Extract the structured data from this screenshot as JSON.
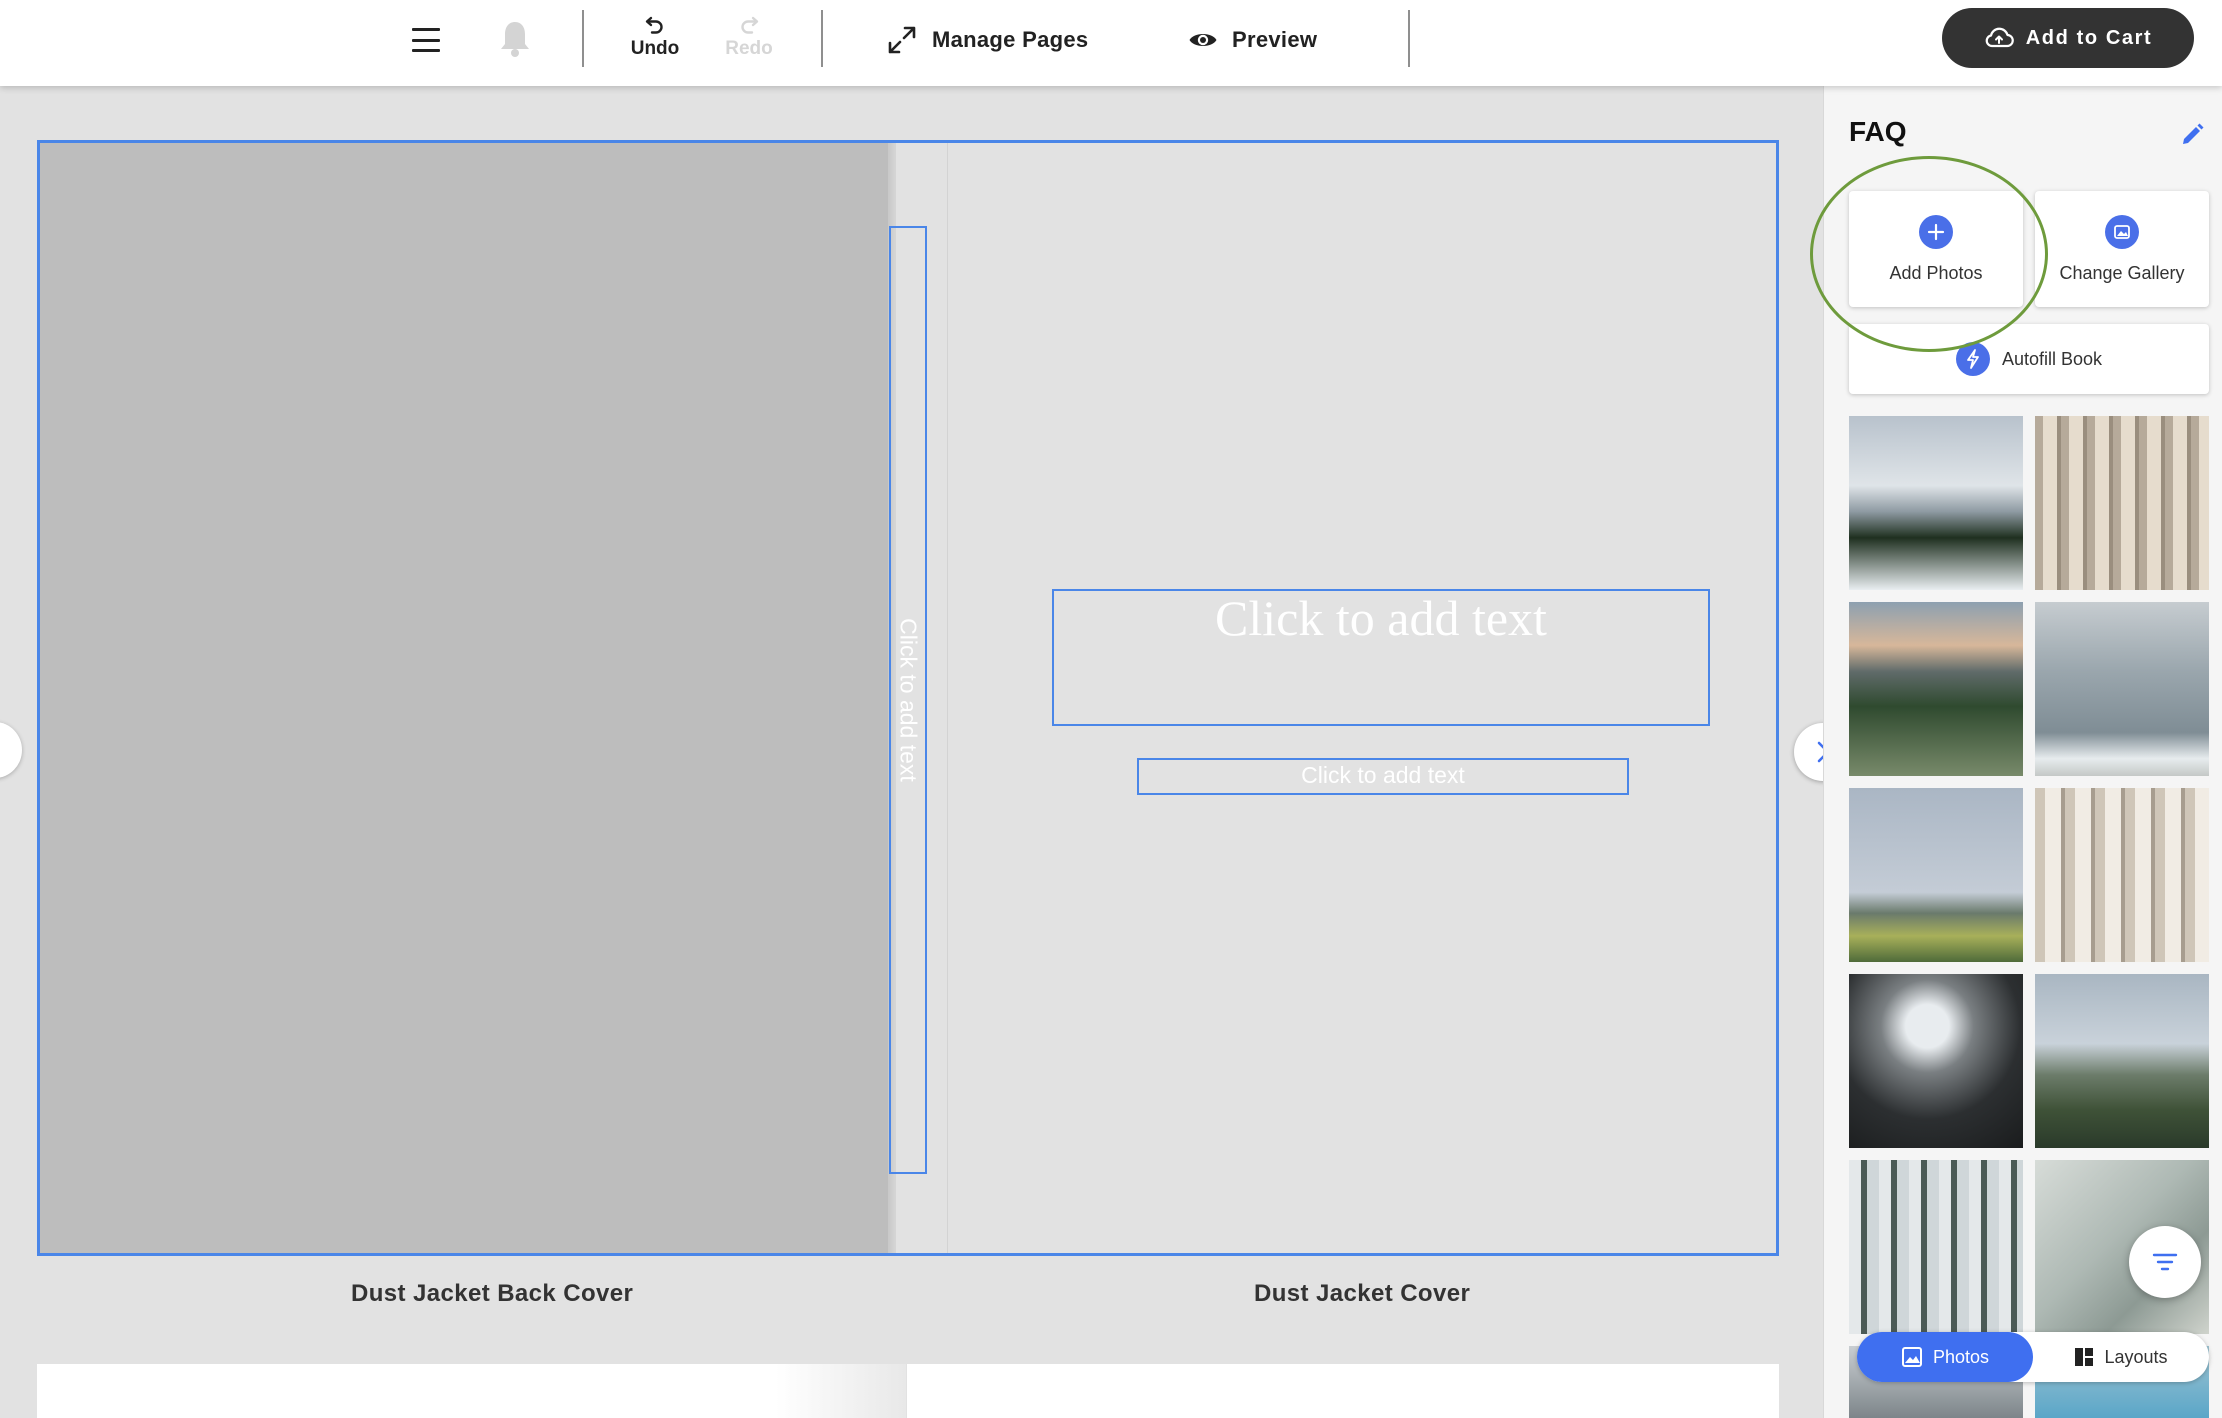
{
  "toolbar": {
    "menu_icon": "hamburger-menu-icon",
    "bell_icon": "bell-icon",
    "undo_label": "Undo",
    "redo_label": "Redo",
    "manage_pages_label": "Manage Pages",
    "preview_label": "Preview",
    "add_to_cart_label": "Add to Cart"
  },
  "canvas": {
    "spine_placeholder": "Click to add text",
    "title_placeholder": "Click to add text",
    "subtitle_placeholder": "Click to add text",
    "back_cover_label": "Dust Jacket Back Cover",
    "front_cover_label": "Dust Jacket Cover"
  },
  "panel": {
    "heading": "FAQ",
    "add_photos_label": "Add Photos",
    "change_gallery_label": "Change Gallery",
    "autofill_label": "Autofill Book",
    "tabs": {
      "photos_label": "Photos",
      "layouts_label": "Layouts",
      "active": "Photos"
    },
    "photos": [
      {
        "subject": "snowy mountain with pine trees"
      },
      {
        "subject": "row of surfboards"
      },
      {
        "subject": "mountain sunset over forest"
      },
      {
        "subject": "ocean waves"
      },
      {
        "subject": "coastal path with yellow flowers"
      },
      {
        "subject": "surfboards rack"
      },
      {
        "subject": "dark shower window with towel"
      },
      {
        "subject": "coastal cliffs and houses"
      },
      {
        "subject": "snowy forest"
      },
      {
        "subject": "tiled bathroom with towel"
      },
      {
        "subject": "partial photo"
      },
      {
        "subject": "partial photo"
      }
    ]
  },
  "colors": {
    "accent": "#4a86e8",
    "button_blue": "#4a6fe8",
    "cart_button": "#333333",
    "highlight_ring": "#6e9b3c",
    "redo_disabled": "#d6d6d6"
  }
}
